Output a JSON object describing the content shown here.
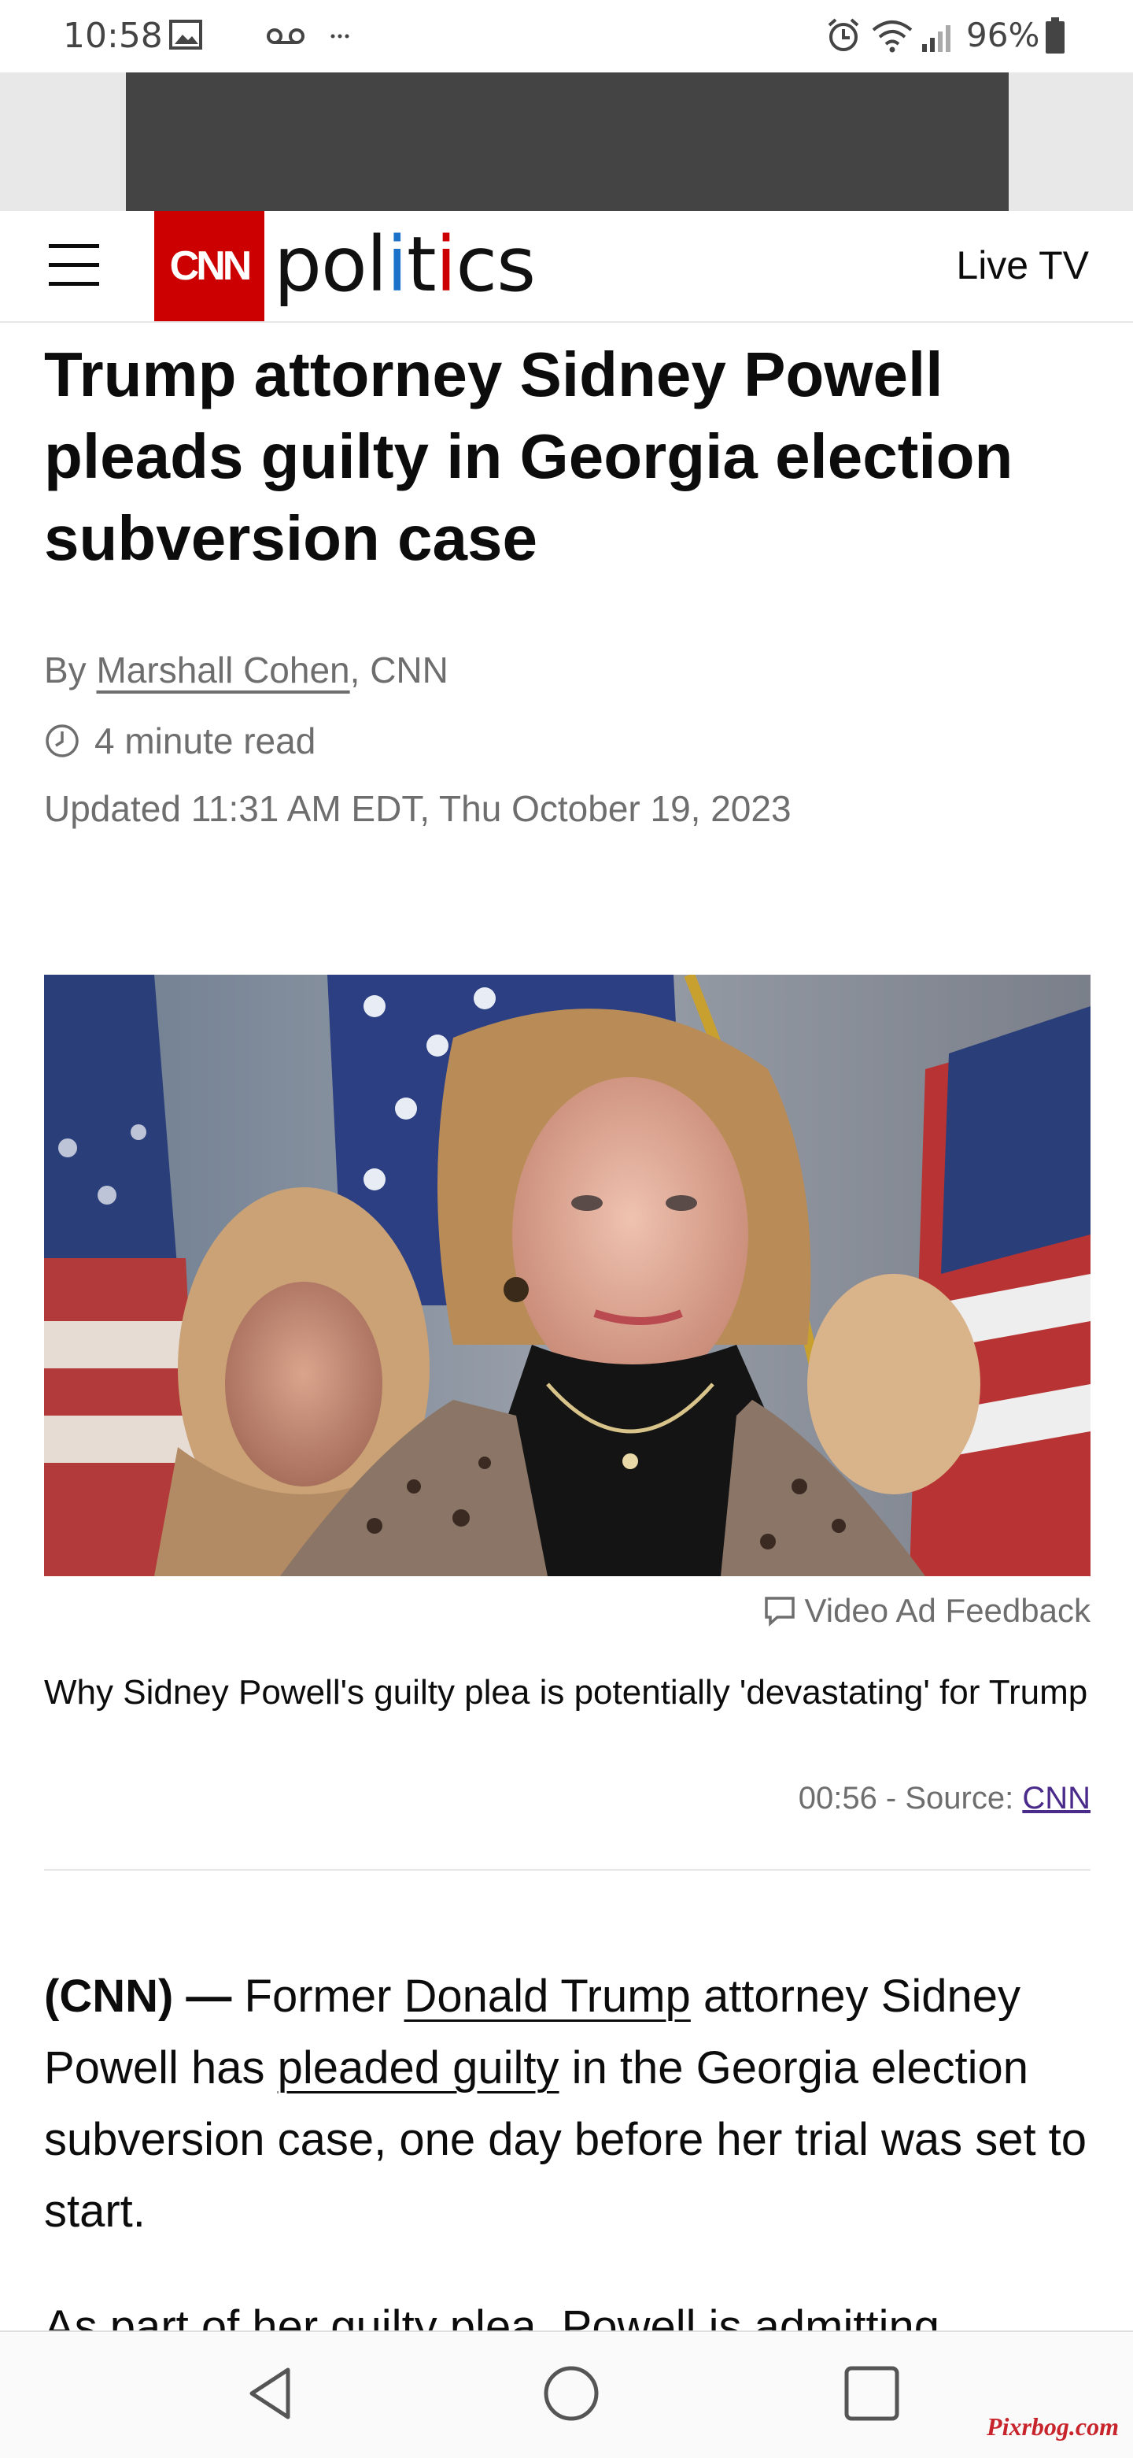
{
  "status_bar": {
    "time": "10:58",
    "battery": "96%",
    "icons": [
      "image-icon",
      "voicemail-icon",
      "more-icon",
      "alarm-icon",
      "wifi-icon",
      "signal-icon",
      "battery-icon"
    ]
  },
  "header": {
    "logo_text": "CNN",
    "section_parts": [
      "pol",
      "i",
      "t",
      "i",
      "cs"
    ],
    "live_tv": "Live TV"
  },
  "article": {
    "headline": "Trump attorney Sidney Powell pleads guilty in Georgia election subversion case",
    "by_prefix": "By ",
    "author": "Marshall Cohen",
    "by_suffix": ", CNN",
    "read_time": "4 minute read",
    "updated": "Updated 11:31 AM EDT, Thu October 19, 2023"
  },
  "video": {
    "ad_feedback": "Video Ad Feedback",
    "caption": "Why Sidney Powell's guilty plea is potentially 'devastating' for Trump",
    "duration_source": "00:56 - Source: ",
    "source_link": "CNN"
  },
  "body": {
    "lead": "(CNN) —",
    "p1_part1": " Former ",
    "link1": "Donald Trump",
    "p1_part2": " attorney Sidney Powell has ",
    "link2": "pleaded guilty",
    "p1_part3": " in the Georgia election subversion case, one day before her trial was set to start.",
    "p2_partial": "As part of her guilty plea, Powell is admitting"
  },
  "nav": {
    "buttons": [
      "back-icon",
      "home-icon",
      "recents-icon"
    ]
  },
  "watermark": "Pixrbog.com",
  "colors": {
    "cnn_red": "#cc0000",
    "politics_blue_i": "#1a73c8",
    "text": "#0c0c0c",
    "meta_gray": "#6e6e6e"
  }
}
